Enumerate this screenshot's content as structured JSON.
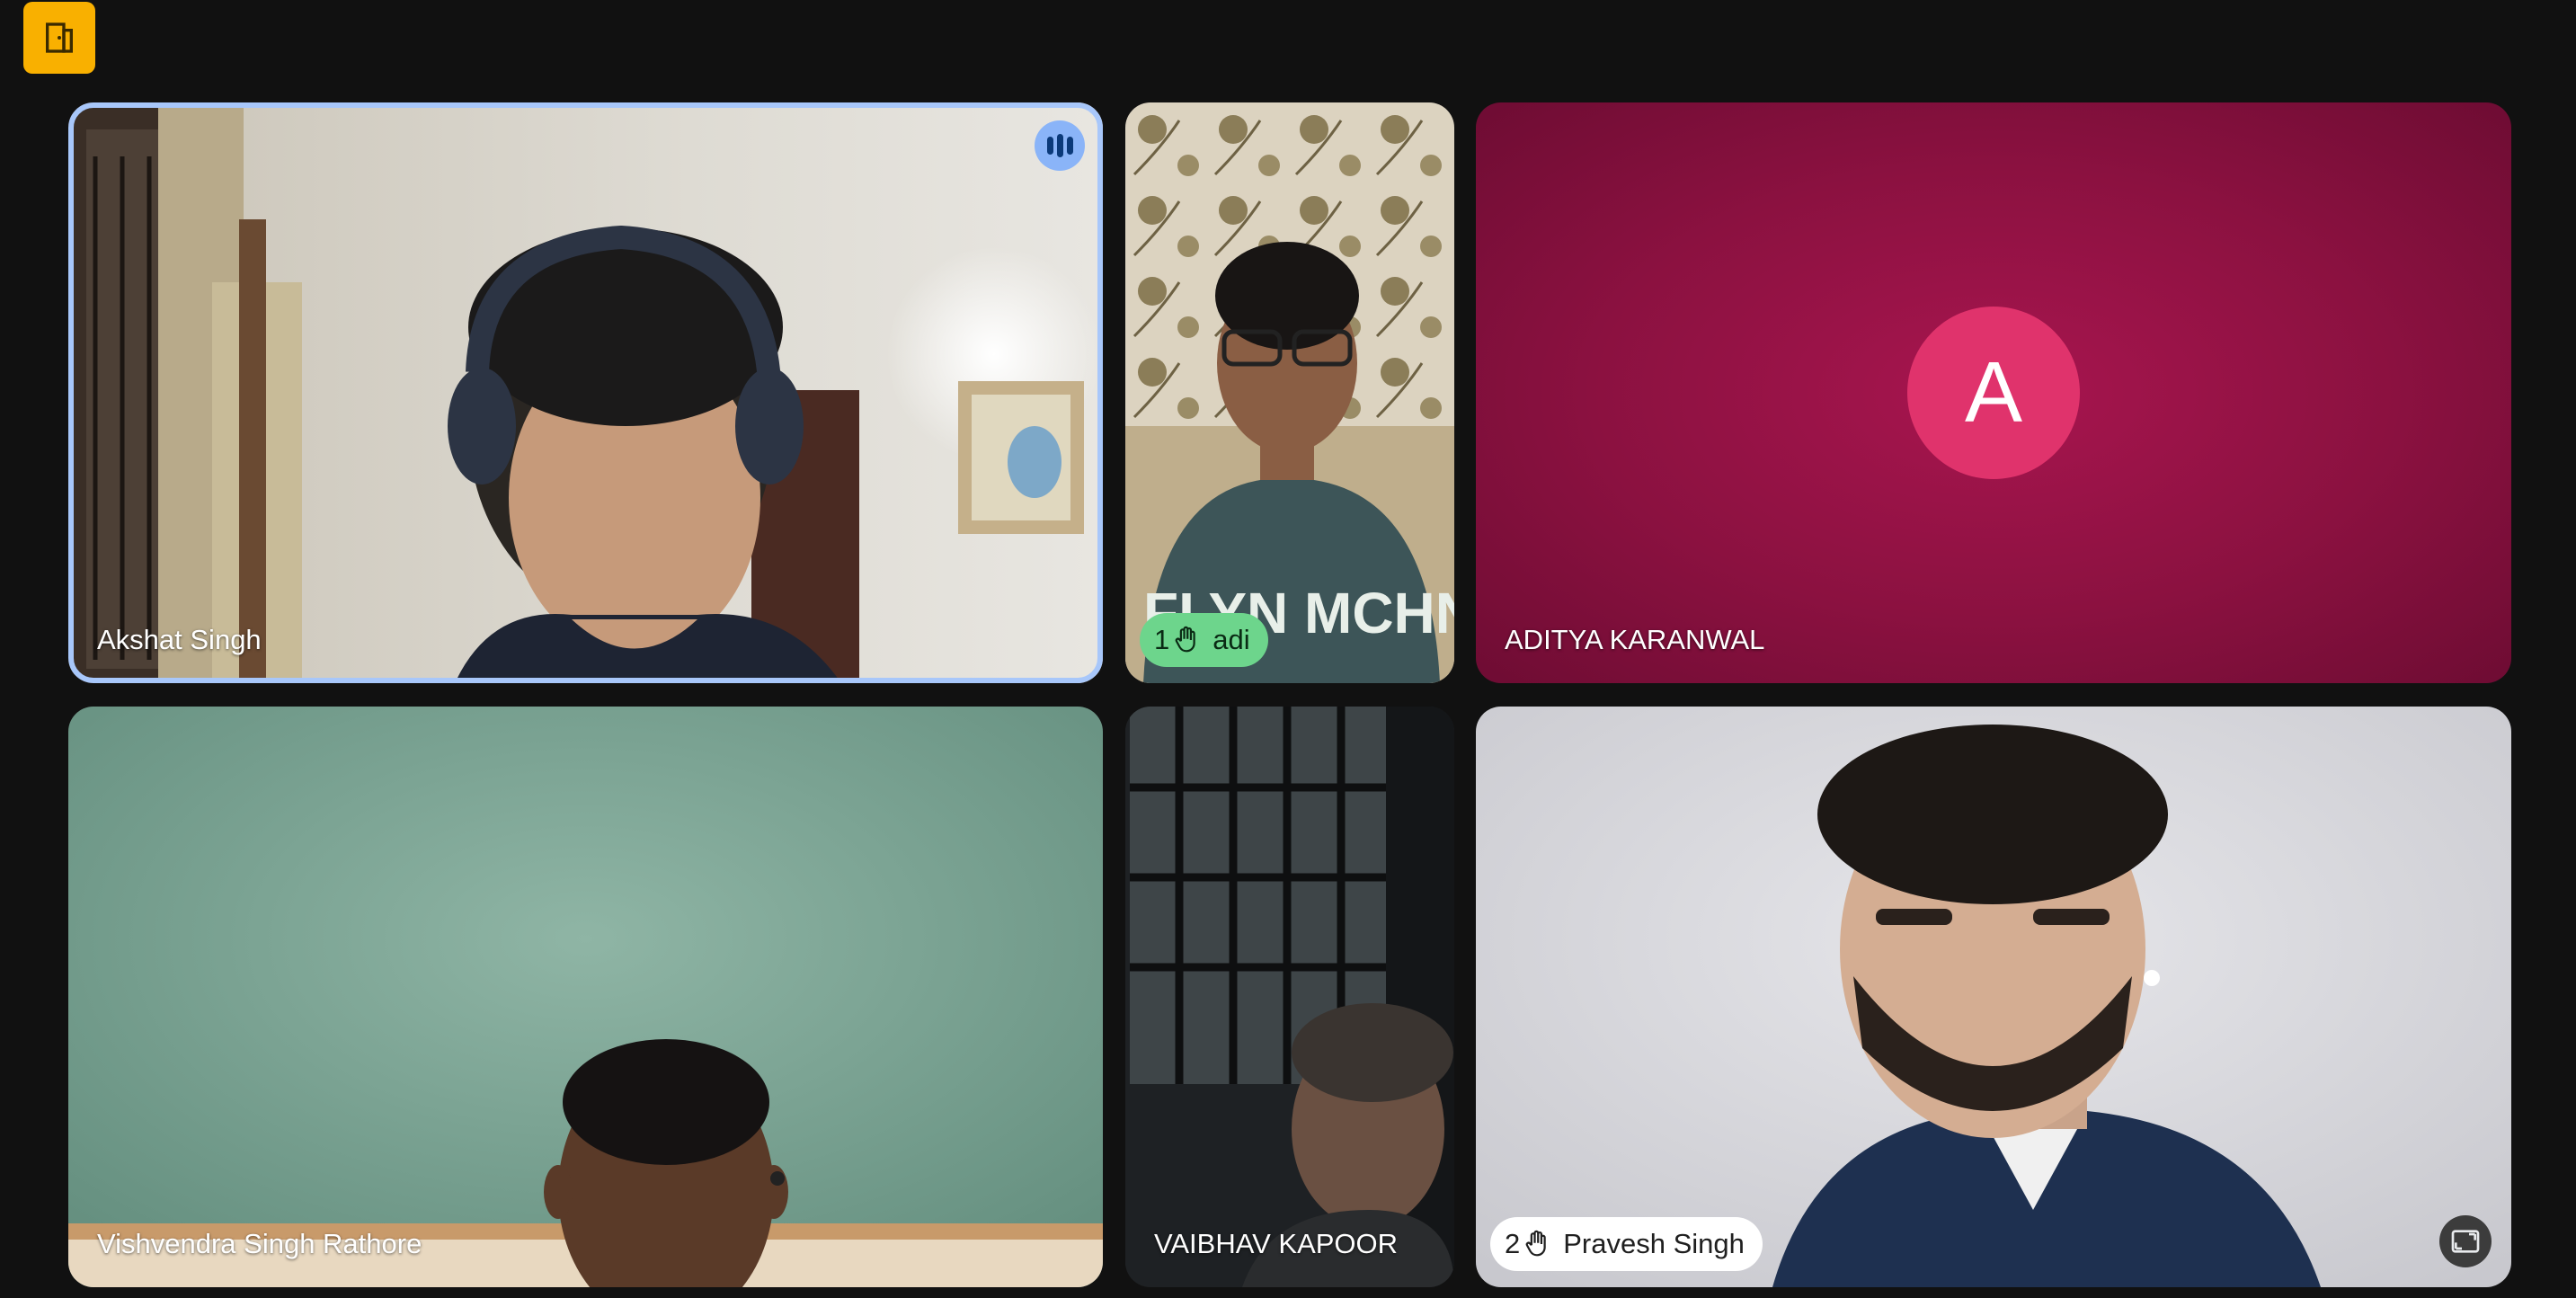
{
  "toolbar": {
    "exit_icon": "door-exit-icon",
    "accent": "#f9b000"
  },
  "tiles": [
    {
      "name": "Akshat Singh",
      "speaking": true,
      "speaking_icon": "audio-wave-icon"
    },
    {
      "name": "adi",
      "hand_raise_order": "1",
      "hand_icon": "raised-hand-icon",
      "chip_color": "#6dd58c"
    },
    {
      "name": "ADITYA KARANWAL",
      "avatar_letter": "A",
      "avatar_color": "#e0336c",
      "background": "#8b1140"
    },
    {
      "name": "Vishvendra Singh Rathore"
    },
    {
      "name": "VAIBHAV KAPOOR"
    },
    {
      "name": "Pravesh Singh",
      "hand_raise_order": "2",
      "hand_icon": "raised-hand-icon",
      "chip_color": "#ffffff",
      "pip_icon": "picture-in-picture-icon"
    }
  ]
}
